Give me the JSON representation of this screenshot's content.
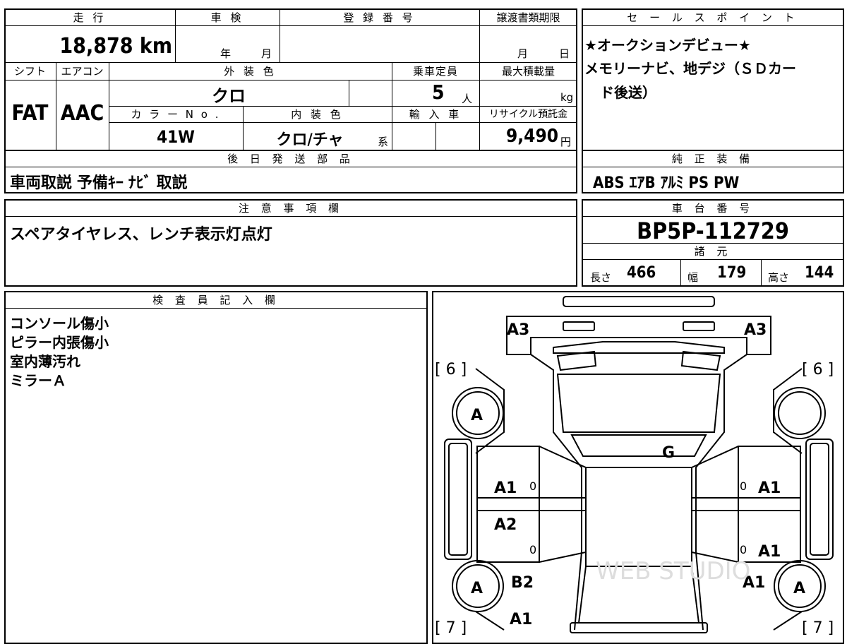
{
  "vehicle_table": {
    "headers": {
      "mileage": "走 行",
      "inspection": "車 検",
      "registration": "登 録 番 号",
      "transfer_deadline": "譲渡書類期限",
      "shift": "シフト",
      "aircon": "エアコン",
      "exterior_color": "外 装 色",
      "capacity": "乗車定員",
      "max_load": "最大積載量",
      "color_no": "カ ラ ー  N o .",
      "interior_color": "内 装 色",
      "imported": "輸 入 車",
      "recycle_fee": "リサイクル預託金"
    },
    "values": {
      "mileage": "18,878 km",
      "inspection_year_unit": "年",
      "inspection_month_unit": "月",
      "transfer_month_unit": "月",
      "transfer_day_unit": "日",
      "shift": "FAT",
      "aircon": "AAC",
      "exterior_color": "クロ",
      "capacity": "5",
      "capacity_unit": "人",
      "max_load_unit": "kg",
      "color_no": "41W",
      "interior_color": "クロ/チャ",
      "interior_suffix": "系",
      "recycle_fee": "9,490",
      "recycle_unit": "円"
    }
  },
  "later_parts": {
    "header": "後 日 発 送 部 品",
    "value": "車両取説  予備ｷｰ  ﾅﾋﾞ 取説"
  },
  "sales_points": {
    "header": "セ ー ル ス ポ イ ン ト",
    "lines": [
      "★オークションデビュー★",
      "メモリーナビ、地デジ（ＳＤカー",
      "ド後送）"
    ]
  },
  "standard_equipment": {
    "header": "純 正 装 備",
    "value": "ABS  ｴｱB  ｱﾙﾐ  PS  PW"
  },
  "notes": {
    "header": "注 意 事 項 欄",
    "value": "スペアタイヤレス、レンチ表示灯点灯"
  },
  "chassis": {
    "header": "車 台 番 号",
    "value": "BP5P-112729",
    "spec_header": "諸 元",
    "length_label": "長さ",
    "length": "466",
    "width_label": "幅",
    "width": "179",
    "height_label": "高さ",
    "height": "144"
  },
  "inspector": {
    "header": "検 査 員 記 入 欄",
    "lines": [
      "コンソール傷小",
      "ピラー内張傷小",
      "室内薄汚れ",
      "ミラーＡ"
    ]
  },
  "car_diagram": {
    "marks": [
      "A3",
      "A3",
      "[ 6 ]",
      "[ 6 ]",
      "A",
      "G",
      "A1",
      "A1",
      "A2",
      "A1",
      "A",
      "B2",
      "A1",
      "A",
      "A1",
      "[ 7 ]",
      "[ 7 ]"
    ],
    "zero_marks": [
      "0",
      "0",
      "0",
      "0"
    ],
    "watermark": "WEB STUDIO"
  }
}
